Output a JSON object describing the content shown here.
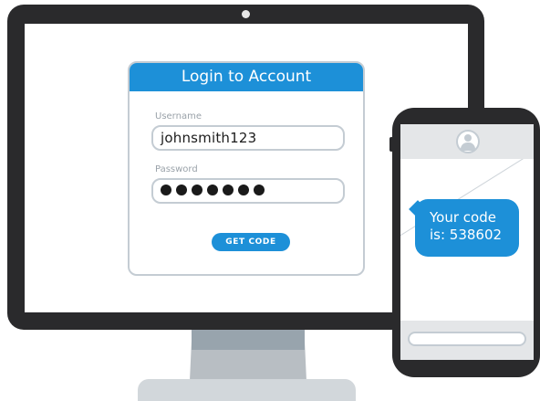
{
  "login_form": {
    "title": "Login to Account",
    "username_label": "Username",
    "username_value": "johnsmith123",
    "password_label": "Password",
    "password_masked_length": 7,
    "submit_label": "GET CODE"
  },
  "phone": {
    "sms_message": "Your code is: 538602"
  },
  "colors": {
    "accent": "#1d90d8",
    "device_frame": "#2a2a2c",
    "border": "#c4ccd3",
    "bar_gray": "#e4e6e8"
  },
  "icons": [
    "contact-avatar-icon",
    "camera-dot-icon"
  ]
}
